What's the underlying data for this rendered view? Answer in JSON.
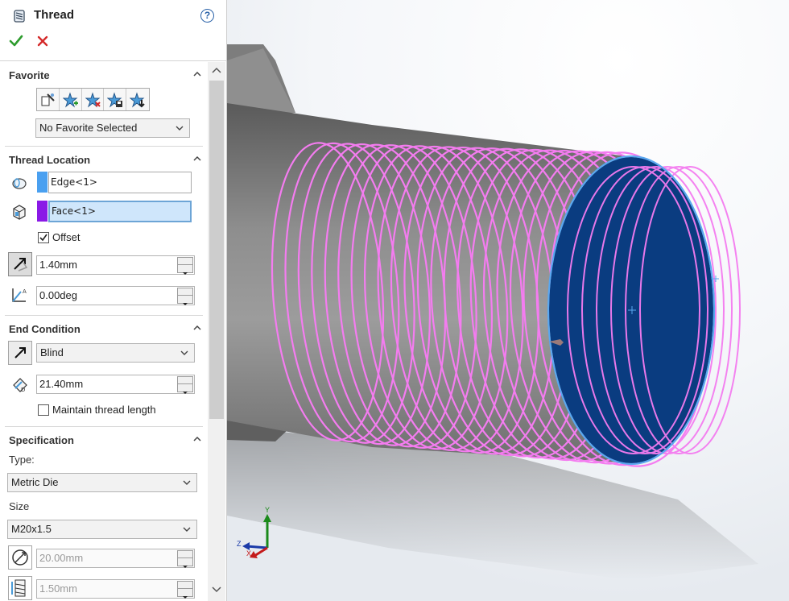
{
  "panel": {
    "title": "Thread",
    "help_label": "?",
    "favorite": {
      "title": "Favorite",
      "buttons": [
        "apply-defaults-icon",
        "add-favorite-icon",
        "delete-favorite-icon",
        "save-favorite-icon",
        "load-favorite-icon"
      ],
      "selected": "No Favorite Selected"
    },
    "thread_location": {
      "title": "Thread Location",
      "edge": {
        "value": "Edge<1>",
        "color": "#4aa0f0"
      },
      "face": {
        "value": "Face<1>",
        "color": "#8a19e6"
      },
      "offset_label": "Offset",
      "offset_checked": true,
      "offset_distance": "1.40mm",
      "start_angle": "0.00deg"
    },
    "end_condition": {
      "title": "End Condition",
      "type": "Blind",
      "depth": "21.40mm",
      "maintain_label": "Maintain thread length",
      "maintain_checked": false
    },
    "specification": {
      "title": "Specification",
      "type_label": "Type:",
      "type": "Metric Die",
      "size_label": "Size",
      "size": "M20x1.5",
      "diameter": "20.00mm",
      "pitch": "1.50mm"
    }
  },
  "viewport": {
    "triad": {
      "x": "X",
      "y": "Y",
      "z": "Z"
    },
    "colors": {
      "thread": "#f47cf0",
      "end_face": "#0a3c80",
      "edge_highlight": "#5aa8f0",
      "body": "#8a8a8a"
    }
  }
}
